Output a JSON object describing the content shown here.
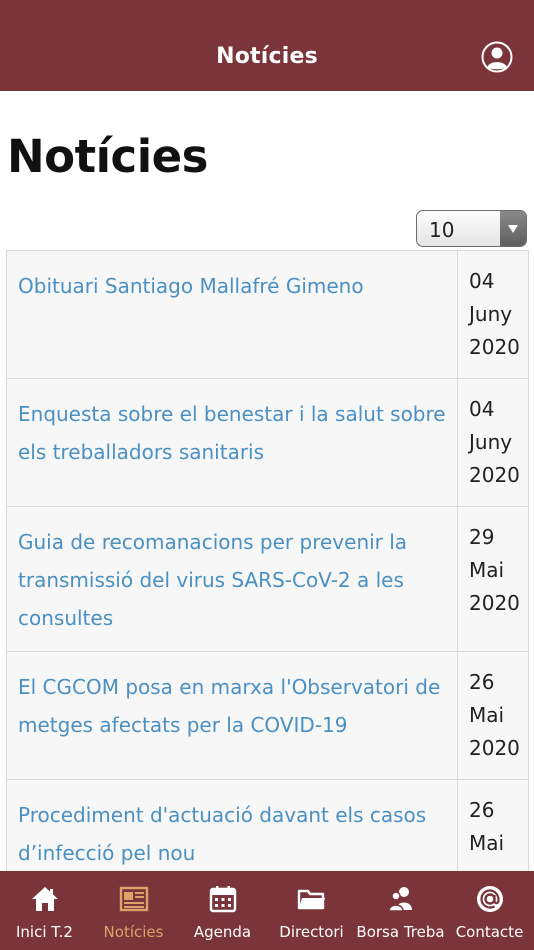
{
  "header": {
    "title": "Notícies",
    "profile_icon": "user-circle-icon"
  },
  "page": {
    "heading": "Notícies"
  },
  "page_size": {
    "selected": "10"
  },
  "news": [
    {
      "title": "Obituari Santiago Mallafré Gimeno",
      "day": "04",
      "month": "Juny",
      "year": "2020"
    },
    {
      "title": "Enquesta sobre el benestar i la salut sobre els treballadors sanitaris",
      "day": "04",
      "month": "Juny",
      "year": "2020"
    },
    {
      "title": "Guia de recomanacions per prevenir la transmissió del virus SARS-CoV-2 a les consultes",
      "day": "29",
      "month": "Mai",
      "year": "2020"
    },
    {
      "title": "El CGCOM posa en marxa l'Observatori de metges afectats per la COVID-19",
      "day": "26",
      "month": "Mai",
      "year": "2020"
    },
    {
      "title": "Procediment d'actuació davant els casos d’infecció pel nou",
      "day": "26",
      "month": "Mai",
      "year": ""
    }
  ],
  "nav": [
    {
      "label": "Inici T.2",
      "icon": "home-icon"
    },
    {
      "label": "Notícies",
      "icon": "newspaper-icon",
      "active": true
    },
    {
      "label": "Agenda",
      "icon": "calendar-icon"
    },
    {
      "label": "Directori",
      "icon": "folder-icon"
    },
    {
      "label": "Borsa Treba",
      "icon": "people-icon"
    },
    {
      "label": "Contacte",
      "icon": "at-icon"
    }
  ],
  "colors": {
    "brand": "#7a343a",
    "link": "#4a90c2",
    "nav_active": "#d9a36a"
  }
}
